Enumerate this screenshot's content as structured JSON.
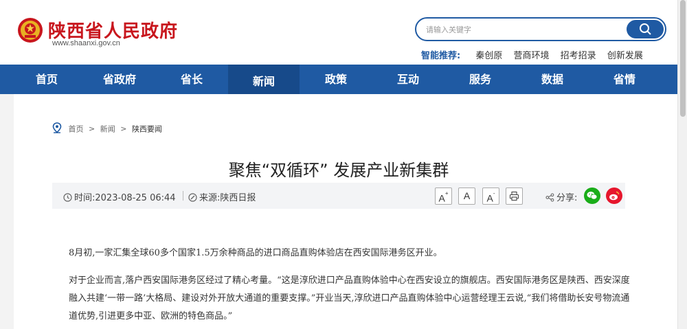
{
  "site": {
    "name": "陕西省人民政府",
    "url": "www.shaanxi.gov.cn",
    "emblem_icon": "national-emblem-icon",
    "brand_color": "#c8161d",
    "nav_color": "#1f5aa3"
  },
  "search": {
    "placeholder": "请输入关键字",
    "button_icon": "search-icon"
  },
  "smart_recommend": {
    "label": "智能推荐:",
    "items": [
      "秦创原",
      "营商环境",
      "招考招录",
      "创新发展"
    ]
  },
  "nav": {
    "items": [
      "首页",
      "省政府",
      "省长",
      "新闻",
      "政策",
      "互动",
      "服务",
      "数据",
      "省情"
    ],
    "active": "新闻"
  },
  "breadcrumb": {
    "items": [
      "首页",
      "新闻",
      "陕西要闻"
    ],
    "separator": ">"
  },
  "article": {
    "title": "聚焦“双循环” 发展产业新集群",
    "time_label": "时间:",
    "time": "2023-08-25 06:44",
    "source_label": "来源:",
    "source": "陕西日报",
    "font_buttons": [
      "A",
      "A",
      "A"
    ],
    "font_increase_sup": "+",
    "font_decrease_sup": "-",
    "share_label": "分享:",
    "paragraphs": [
      "8月初,一家汇集全球60多个国家1.5万余种商品的进口商品直购体验店在西安国际港务区开业。",
      "对于企业而言,落户西安国际港务区经过了精心考量。“这是淳欣进口产品直购体验中心在西安设立的旗舰店。西安国际港务区是陕西、西安深度融入共建‘一带一路’大格局、建设对外开放大通道的重要支撑。”开业当天,淳欣进口产品直购体验中心运营经理王云说,“我们将借助长安号物流通道优势,引进更多中亚、欧洲的特色商品。”"
    ]
  }
}
